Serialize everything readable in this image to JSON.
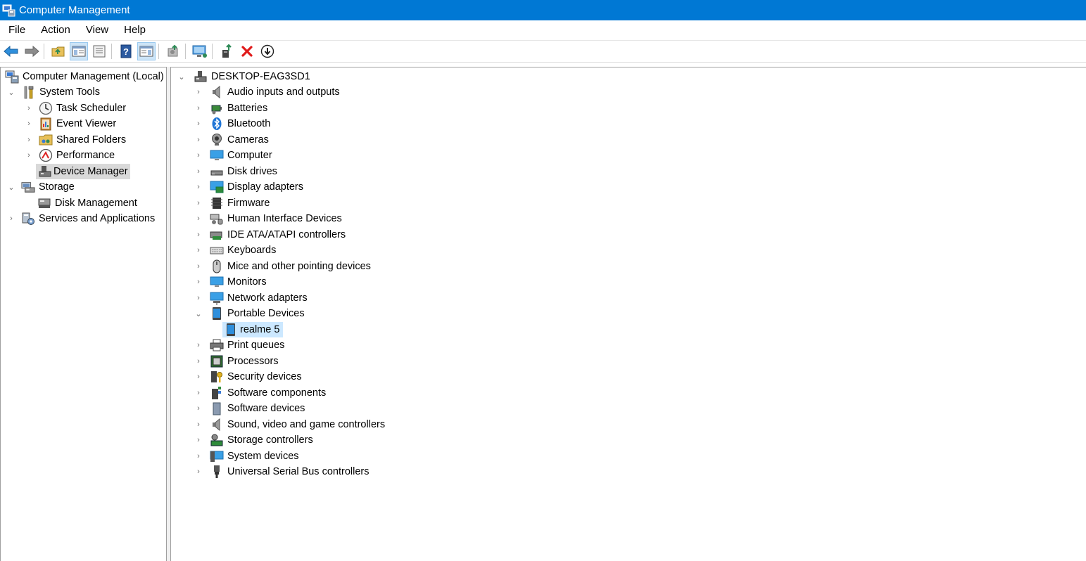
{
  "window": {
    "title": "Computer Management"
  },
  "menu": [
    "File",
    "Action",
    "View",
    "Help"
  ],
  "left_tree": [
    {
      "label": "Computer Management (Local)",
      "icon": "computer-management-icon",
      "expander": "none"
    },
    {
      "label": "System Tools",
      "icon": "tools-icon",
      "expander": "expanded"
    },
    {
      "label": "Task Scheduler",
      "icon": "clock-icon",
      "expander": "collapsed"
    },
    {
      "label": "Event Viewer",
      "icon": "event-viewer-icon",
      "expander": "collapsed"
    },
    {
      "label": "Shared Folders",
      "icon": "shared-folder-icon",
      "expander": "collapsed"
    },
    {
      "label": "Performance",
      "icon": "performance-icon",
      "expander": "collapsed"
    },
    {
      "label": "Device Manager",
      "icon": "device-manager-icon",
      "expander": "none",
      "selected": true
    },
    {
      "label": "Storage",
      "icon": "storage-icon",
      "expander": "expanded"
    },
    {
      "label": "Disk Management",
      "icon": "disk-management-icon",
      "expander": "none"
    },
    {
      "label": "Services and Applications",
      "icon": "services-icon",
      "expander": "collapsed"
    }
  ],
  "device_tree": {
    "root": "DESKTOP-EAG3SD1",
    "items": [
      {
        "label": "Audio inputs and outputs",
        "icon": "speaker-icon"
      },
      {
        "label": "Batteries",
        "icon": "battery-icon"
      },
      {
        "label": "Bluetooth",
        "icon": "bluetooth-icon"
      },
      {
        "label": "Cameras",
        "icon": "camera-icon"
      },
      {
        "label": "Computer",
        "icon": "monitor-icon"
      },
      {
        "label": "Disk drives",
        "icon": "disk-drive-icon"
      },
      {
        "label": "Display adapters",
        "icon": "display-adapter-icon"
      },
      {
        "label": "Firmware",
        "icon": "firmware-icon"
      },
      {
        "label": "Human Interface Devices",
        "icon": "hid-icon"
      },
      {
        "label": "IDE ATA/ATAPI controllers",
        "icon": "ide-controller-icon"
      },
      {
        "label": "Keyboards",
        "icon": "keyboard-icon"
      },
      {
        "label": "Mice and other pointing devices",
        "icon": "mouse-icon"
      },
      {
        "label": "Monitors",
        "icon": "monitor-icon"
      },
      {
        "label": "Network adapters",
        "icon": "network-icon"
      },
      {
        "label": "Portable Devices",
        "icon": "portable-device-icon",
        "expanded": true,
        "children": [
          {
            "label": "realme 5",
            "icon": "portable-device-icon",
            "selected": true
          }
        ]
      },
      {
        "label": "Print queues",
        "icon": "printer-icon"
      },
      {
        "label": "Processors",
        "icon": "processor-icon"
      },
      {
        "label": "Security devices",
        "icon": "security-icon"
      },
      {
        "label": "Software components",
        "icon": "software-component-icon"
      },
      {
        "label": "Software devices",
        "icon": "software-device-icon"
      },
      {
        "label": "Sound, video and game controllers",
        "icon": "speaker-icon"
      },
      {
        "label": "Storage controllers",
        "icon": "storage-controller-icon"
      },
      {
        "label": "System devices",
        "icon": "system-device-icon"
      },
      {
        "label": "Universal Serial Bus controllers",
        "icon": "usb-icon"
      }
    ]
  },
  "colors": {
    "titlebar": "#0078d4",
    "selection_blue": "#cce8ff",
    "selection_gray": "#d9d9d9"
  }
}
